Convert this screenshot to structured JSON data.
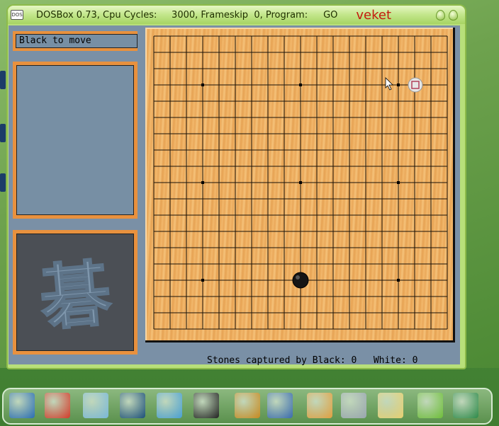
{
  "window": {
    "title_info": "DOSBox 0.73, Cpu Cycles:     3000, Frameskip  0, Program:",
    "program": "GO",
    "brand": "veket"
  },
  "game": {
    "turn_status": "Black to move",
    "captured_label": "Stones captured by Black:",
    "captured_black": "0",
    "white_label": "White:",
    "captured_white": "0",
    "logo_char": "碁"
  },
  "board": {
    "size": 19,
    "star_points": [
      [
        3,
        3
      ],
      [
        3,
        9
      ],
      [
        3,
        15
      ],
      [
        9,
        3
      ],
      [
        9,
        9
      ],
      [
        9,
        15
      ],
      [
        15,
        3
      ],
      [
        15,
        9
      ],
      [
        15,
        15
      ]
    ],
    "stones": [
      {
        "color": "black",
        "row": 15,
        "col": 9
      }
    ],
    "cursor": {
      "row": 3,
      "col": 16
    }
  },
  "taskbar": {
    "icons": [
      "monitor-icon",
      "pig-icon",
      "pen-icon",
      "media-player-icon",
      "network-user-icon",
      "penguin-icon",
      "exit-door-icon",
      "slideshow-icon",
      "paint-palette-icon",
      "usb-drive-icon",
      "photo-icon",
      "help-icon",
      "camera-icon"
    ]
  },
  "colors": {
    "board": "#f0b466",
    "panel_border": "#e8913e",
    "panel_fill": "#778fa4",
    "titlebar": "#b8e07a",
    "brand": "#c41a0e"
  }
}
